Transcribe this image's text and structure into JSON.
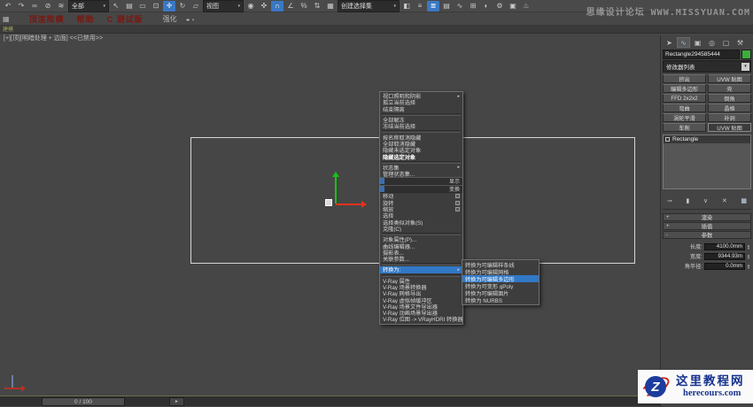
{
  "toolbar": {
    "items": [
      {
        "name": "undo-icon",
        "glyph": "↶"
      },
      {
        "name": "redo-icon",
        "glyph": "↷"
      },
      {
        "name": "select-link-icon",
        "glyph": "∞"
      },
      {
        "name": "unlink-icon",
        "glyph": "⊘"
      },
      {
        "name": "bind-spacewarp-icon",
        "glyph": "≋"
      },
      {
        "name": "selection-filter-dropdown",
        "select": true,
        "w1": true,
        "value": "全部"
      },
      {
        "name": "select-object-icon",
        "glyph": "↖"
      },
      {
        "name": "select-by-name-icon",
        "glyph": "▤"
      },
      {
        "name": "rect-region-icon",
        "glyph": "▭"
      },
      {
        "name": "window-crossing-icon",
        "glyph": "⊡"
      },
      {
        "name": "select-move-icon",
        "glyph": "✛",
        "active": true
      },
      {
        "name": "select-rotate-icon",
        "glyph": "↻"
      },
      {
        "name": "select-scale-icon",
        "glyph": "▱"
      },
      {
        "name": "ref-coord-dropdown",
        "select": true,
        "w1": true,
        "value": "视图"
      },
      {
        "name": "use-pivot-icon",
        "glyph": "◉"
      },
      {
        "name": "select-manipulate-icon",
        "glyph": "✜"
      },
      {
        "name": "snap-toggle-icon",
        "glyph": "∩",
        "active": true
      },
      {
        "name": "angle-snap-icon",
        "glyph": "∠"
      },
      {
        "name": "percent-snap-icon",
        "glyph": "%"
      },
      {
        "name": "spinner-snap-icon",
        "glyph": "⇅"
      },
      {
        "name": "edit-named-sets-icon",
        "glyph": "▦"
      },
      {
        "name": "named-sets-dropdown",
        "select": true,
        "w3": true,
        "value": "创建选择集"
      },
      {
        "name": "mirror-icon",
        "glyph": "◧"
      },
      {
        "name": "align-icon",
        "glyph": "≡"
      },
      {
        "name": "layer-manager-icon",
        "glyph": "≣",
        "active": true
      },
      {
        "name": "ribbon-toggle-icon",
        "glyph": "▤"
      },
      {
        "name": "curve-editor-icon",
        "glyph": "∿"
      },
      {
        "name": "schematic-view-icon",
        "glyph": "⊞"
      },
      {
        "name": "material-editor-icon",
        "glyph": "◐"
      },
      {
        "name": "render-setup-icon",
        "glyph": "⚙"
      },
      {
        "name": "rendered-frame-icon",
        "glyph": "▣"
      },
      {
        "name": "render-icon",
        "glyph": "♨"
      }
    ]
  },
  "toolbar2": {
    "grid_icon": "▦",
    "red_items": [
      "顶渲简模",
      "帮助",
      "C 测试版"
    ],
    "label": "强化",
    "toggle_glyph": "◒",
    "caret": "▾"
  },
  "ribbon_tab": "建模",
  "viewport": {
    "label": "[+][顶][明暗处理 + 边面] <<已禁用>>"
  },
  "context_menu": {
    "items": [
      {
        "label": "视口照明和阴影",
        "hasarrow": true
      },
      {
        "label": "孤立当前选择"
      },
      {
        "label": "结束隔离"
      },
      {
        "separator": true
      },
      {
        "label": "全部解冻"
      },
      {
        "label": "冻结当前选择"
      },
      {
        "separator": true
      },
      {
        "label": "按名称取消隐藏"
      },
      {
        "label": "全部取消隐藏"
      },
      {
        "label": "隐藏未选定对象"
      },
      {
        "label": "隐藏选定对象",
        "bold": true
      },
      {
        "separator": true
      },
      {
        "label": "状态集",
        "hasarrow": true
      },
      {
        "label": "管理状态集..."
      },
      {
        "label": "显示",
        "header": true
      },
      {
        "label": "变换",
        "header": true
      },
      {
        "label": "移动",
        "settings": true
      },
      {
        "label": "旋转",
        "settings": true
      },
      {
        "label": "缩放",
        "settings": true
      },
      {
        "label": "选择"
      },
      {
        "label": "选择类似对象(S)"
      },
      {
        "label": "克隆(C)"
      },
      {
        "separator": true
      },
      {
        "label": "对象属性(P)..."
      },
      {
        "label": "曲线编辑器..."
      },
      {
        "label": "摄影表..."
      },
      {
        "label": "关联参数..."
      },
      {
        "separator": true
      },
      {
        "label": "转换为:",
        "hasarrow": true,
        "hl": true
      },
      {
        "separator": true
      },
      {
        "label": "V-Ray 属性"
      },
      {
        "label": "V-Ray 场景转换器"
      },
      {
        "label": "V-Ray 网格导出"
      },
      {
        "label": "V-Ray 虚拟帧缓冲区"
      },
      {
        "label": "V-Ray 场景文件导出器"
      },
      {
        "label": "V-Ray 动画场景导出器"
      },
      {
        "label": "V-Ray 位图 -> VRayHDRI 转换器"
      }
    ]
  },
  "submenu": {
    "items": [
      {
        "label": "转换为可编辑样条线"
      },
      {
        "label": "转换为可编辑网格"
      },
      {
        "label": "转换为可编辑多边形",
        "hl": true
      },
      {
        "label": "转换为可变形 gPoly"
      },
      {
        "label": "转换为可编辑面片"
      },
      {
        "label": "转换为 NURBS"
      }
    ]
  },
  "panel": {
    "tabs": [
      {
        "name": "create-tab-icon",
        "glyph": "➤"
      },
      {
        "name": "modify-tab-icon",
        "glyph": "∿",
        "active": true
      },
      {
        "name": "hierarchy-tab-icon",
        "glyph": "▣"
      },
      {
        "name": "motion-tab-icon",
        "glyph": "◎"
      },
      {
        "name": "display-tab-icon",
        "glyph": "▢"
      },
      {
        "name": "utilities-tab-icon",
        "glyph": "⚒"
      }
    ],
    "object_name": "Rectangle294585444",
    "object_color": "#3cae3c",
    "modifier_list_label": "修改器列表",
    "modifier_buttons": [
      {
        "label": "挤出"
      },
      {
        "label": "UVW 贴图"
      },
      {
        "label": "编辑多边形"
      },
      {
        "label": "壳"
      },
      {
        "label": "FFD 2x2x2"
      },
      {
        "label": "倒角"
      },
      {
        "label": "弯曲"
      },
      {
        "label": "晶格"
      },
      {
        "label": "涡轮平滑"
      },
      {
        "label": "补洞"
      },
      {
        "label": "车削"
      },
      {
        "label": "UVW 贴图",
        "pressed": true
      }
    ],
    "stack_item": "Rectangle",
    "stack_tools": [
      {
        "name": "pin-stack-icon",
        "glyph": "⊸"
      },
      {
        "name": "show-end-result-icon",
        "glyph": "▮"
      },
      {
        "name": "make-unique-icon",
        "glyph": "∨"
      },
      {
        "name": "remove-modifier-icon",
        "glyph": "✕"
      },
      {
        "name": "configure-modifier-sets-icon",
        "glyph": "▦",
        "active": true
      }
    ],
    "rollouts": [
      {
        "label": "渲染",
        "sign": "+"
      },
      {
        "label": "插值",
        "sign": "+"
      },
      {
        "label": "参数",
        "sign": "-"
      }
    ],
    "params": [
      {
        "label": "长度:",
        "value": "4100.0mm"
      },
      {
        "label": "宽度:",
        "value": "9344.93m"
      },
      {
        "label": "角半径:",
        "value": "0.0mm"
      }
    ]
  },
  "timeline": {
    "frame_label": "0 / 100",
    "next_glyph": "►"
  },
  "watermark_top": "思缘设计论坛 WWW.MISSYUAN.COM",
  "watermark_logo": {
    "letter": "Z",
    "title": "这里教程网",
    "url": "herecours.com"
  },
  "colors": {
    "menu_highlight": "#3178c6",
    "viewport_bg": "#464646",
    "gizmo_y": "#14c314",
    "gizmo_x": "#e0321e"
  }
}
